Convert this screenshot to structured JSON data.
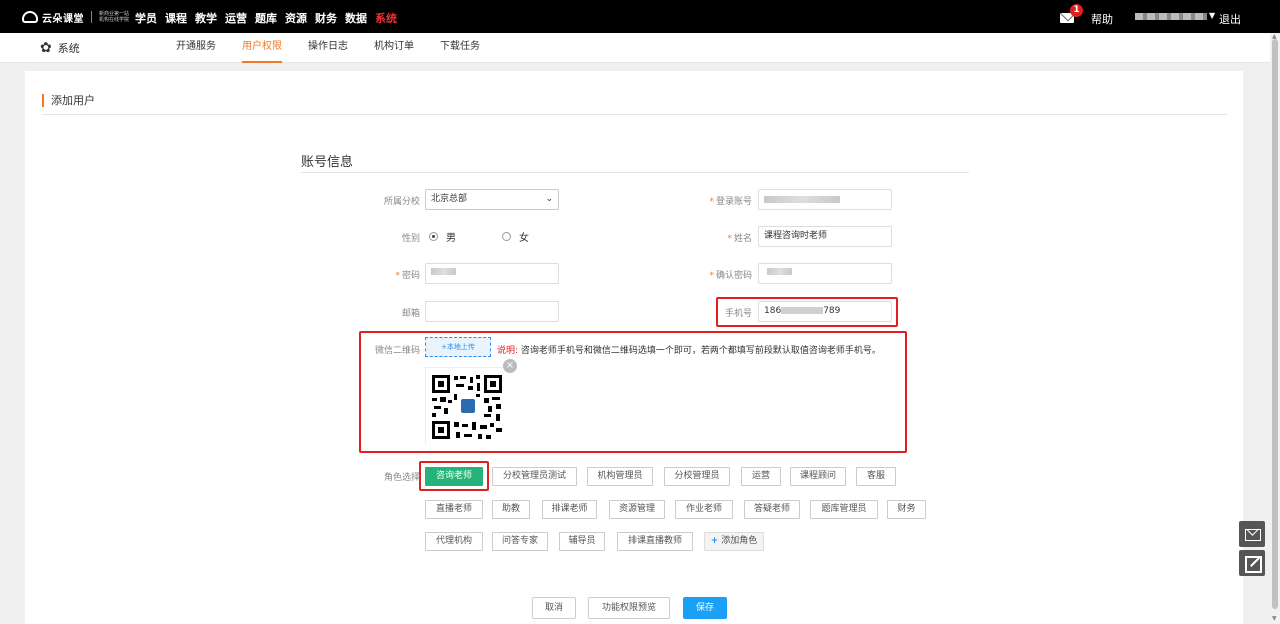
{
  "topbar": {
    "logo_text": "云朵课堂",
    "logo_sub": "新商业第一站 机构在线学院",
    "nav": [
      "学员",
      "课程",
      "教学",
      "运营",
      "题库",
      "资源",
      "财务",
      "数据",
      "系统"
    ],
    "active_nav": "系统",
    "mail_badge": "1",
    "help": "帮助",
    "logout": "退出"
  },
  "subbar": {
    "section": "系统",
    "tabs": [
      "开通服务",
      "用户权限",
      "操作日志",
      "机构订单",
      "下载任务"
    ],
    "active_tab": "用户权限"
  },
  "page": {
    "title": "添加用户",
    "section_title": "账号信息"
  },
  "form": {
    "branch_label": "所属分校",
    "branch_value": "北京总部",
    "login_label": "登录账号",
    "gender_label": "性别",
    "gender_male": "男",
    "gender_female": "女",
    "name_label": "姓名",
    "name_value": "课程咨询时老师",
    "password_label": "密码",
    "confirm_label": "确认密码",
    "email_label": "邮箱",
    "email_value": "",
    "phone_label": "手机号",
    "phone_prefix": "186",
    "phone_suffix": "789",
    "qr_label": "微信二维码",
    "upload_label": "+本地上传",
    "note_label": "说明:",
    "note_text": "咨询老师手机号和微信二维码选填一个即可，若两个都填写前段默认取值咨询老师手机号。",
    "role_label": "角色选择",
    "roles_row1": [
      "咨询老师",
      "分校管理员测试",
      "机构管理员",
      "分校管理员",
      "运营",
      "课程顾问",
      "客服"
    ],
    "roles_row2": [
      "直播老师",
      "助教",
      "排课老师",
      "资源管理",
      "作业老师",
      "答疑老师",
      "题库管理员",
      "财务"
    ],
    "roles_row3": [
      "代理机构",
      "问答专家",
      "辅导员",
      "排课直播教师"
    ],
    "add_role": "添加角色",
    "selected_role": "咨询老师"
  },
  "actions": {
    "cancel": "取消",
    "preview": "功能权限预览",
    "save": "保存"
  },
  "colors": {
    "accent_orange": "#f07a2a",
    "selected_green": "#25b37a",
    "primary_blue": "#1aa0f5",
    "highlight_red": "#e02020"
  }
}
